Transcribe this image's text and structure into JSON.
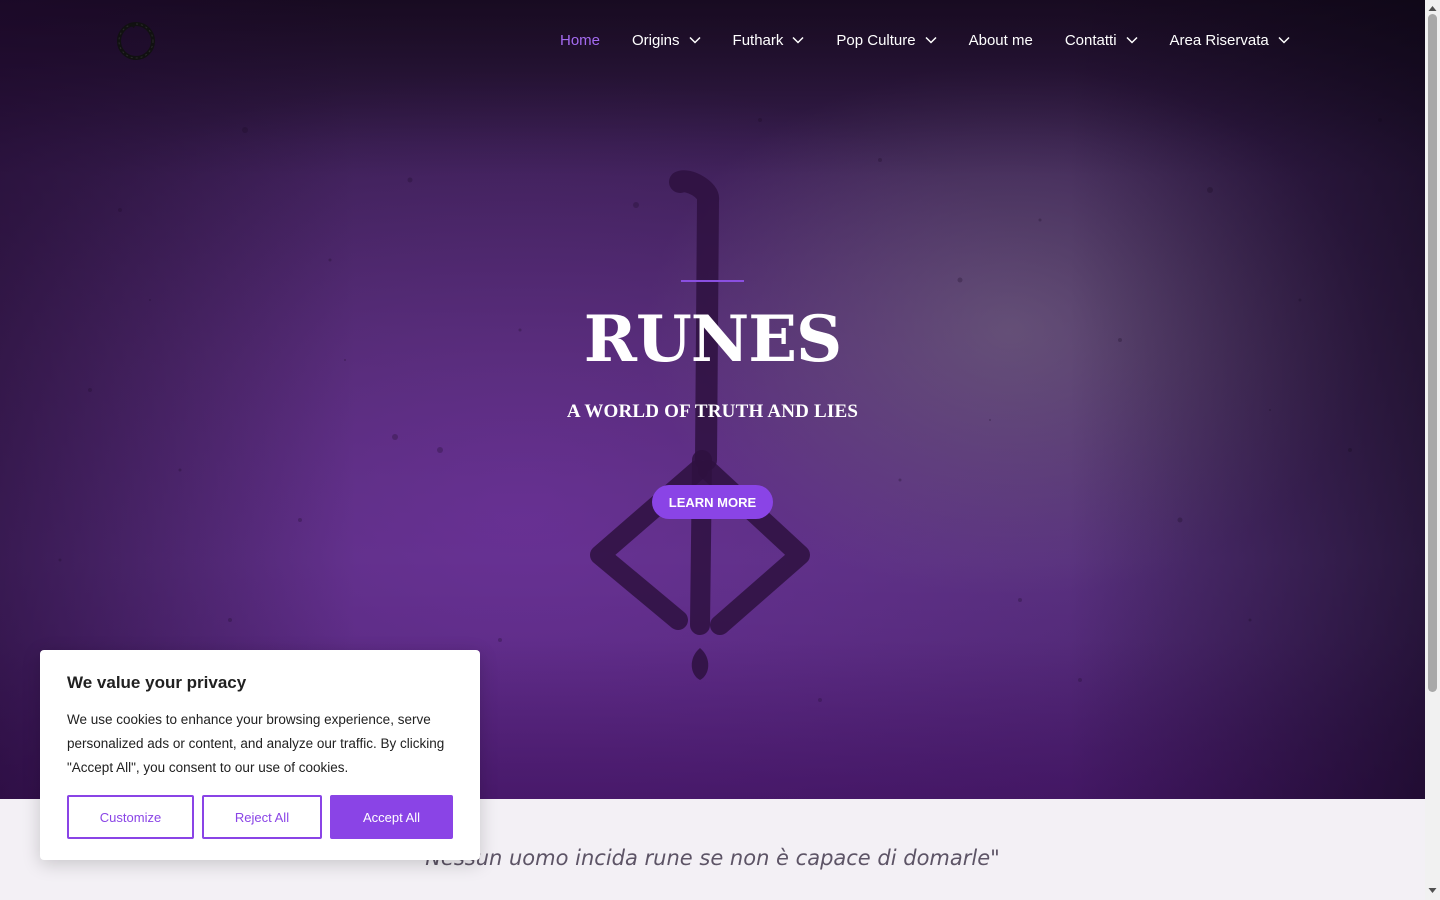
{
  "nav": {
    "items": [
      {
        "label": "Home",
        "dropdown": false,
        "active": true
      },
      {
        "label": "Origins",
        "dropdown": true,
        "active": false
      },
      {
        "label": "Futhark",
        "dropdown": true,
        "active": false
      },
      {
        "label": "Pop Culture",
        "dropdown": true,
        "active": false
      },
      {
        "label": "About me",
        "dropdown": false,
        "active": false
      },
      {
        "label": "Contatti",
        "dropdown": true,
        "active": false
      },
      {
        "label": "Area Riservata",
        "dropdown": true,
        "active": false
      }
    ]
  },
  "hero": {
    "title": "RUNES",
    "subtitle": "A WORLD OF TRUTH AND LIES",
    "cta_label": "LEARN MORE"
  },
  "quote": {
    "text": "Nessun uomo incida rune se non è capace di domarle\""
  },
  "cookie_banner": {
    "title": "We value your privacy",
    "text": "We use cookies to enhance your browsing experience, serve personalized ads or content, and analyze our traffic. By clicking \"Accept All\", you consent to our use of cookies.",
    "customize_label": "Customize",
    "reject_label": "Reject All",
    "accept_label": "Accept All"
  },
  "colors": {
    "accent": "#8a44e6",
    "active_nav": "#a46bf0",
    "hero_base": "#4a2a66"
  },
  "icons": {
    "logo": "ouroboros-ring-icon",
    "dropdown": "chevron-down-icon"
  }
}
